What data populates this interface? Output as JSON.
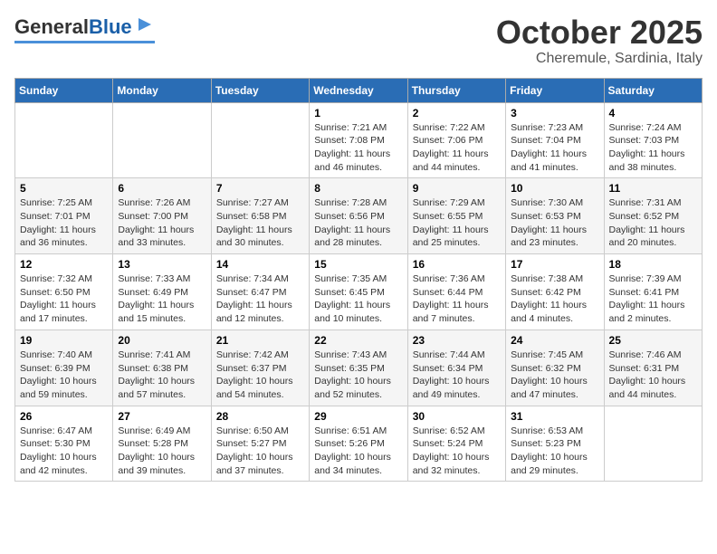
{
  "header": {
    "logo_general": "General",
    "logo_blue": "Blue",
    "month_title": "October 2025",
    "location": "Cheremule, Sardinia, Italy"
  },
  "calendar": {
    "days_of_week": [
      "Sunday",
      "Monday",
      "Tuesday",
      "Wednesday",
      "Thursday",
      "Friday",
      "Saturday"
    ],
    "weeks": [
      [
        {
          "day": "",
          "info": ""
        },
        {
          "day": "",
          "info": ""
        },
        {
          "day": "",
          "info": ""
        },
        {
          "day": "1",
          "info": "Sunrise: 7:21 AM\nSunset: 7:08 PM\nDaylight: 11 hours and 46 minutes."
        },
        {
          "day": "2",
          "info": "Sunrise: 7:22 AM\nSunset: 7:06 PM\nDaylight: 11 hours and 44 minutes."
        },
        {
          "day": "3",
          "info": "Sunrise: 7:23 AM\nSunset: 7:04 PM\nDaylight: 11 hours and 41 minutes."
        },
        {
          "day": "4",
          "info": "Sunrise: 7:24 AM\nSunset: 7:03 PM\nDaylight: 11 hours and 38 minutes."
        }
      ],
      [
        {
          "day": "5",
          "info": "Sunrise: 7:25 AM\nSunset: 7:01 PM\nDaylight: 11 hours and 36 minutes."
        },
        {
          "day": "6",
          "info": "Sunrise: 7:26 AM\nSunset: 7:00 PM\nDaylight: 11 hours and 33 minutes."
        },
        {
          "day": "7",
          "info": "Sunrise: 7:27 AM\nSunset: 6:58 PM\nDaylight: 11 hours and 30 minutes."
        },
        {
          "day": "8",
          "info": "Sunrise: 7:28 AM\nSunset: 6:56 PM\nDaylight: 11 hours and 28 minutes."
        },
        {
          "day": "9",
          "info": "Sunrise: 7:29 AM\nSunset: 6:55 PM\nDaylight: 11 hours and 25 minutes."
        },
        {
          "day": "10",
          "info": "Sunrise: 7:30 AM\nSunset: 6:53 PM\nDaylight: 11 hours and 23 minutes."
        },
        {
          "day": "11",
          "info": "Sunrise: 7:31 AM\nSunset: 6:52 PM\nDaylight: 11 hours and 20 minutes."
        }
      ],
      [
        {
          "day": "12",
          "info": "Sunrise: 7:32 AM\nSunset: 6:50 PM\nDaylight: 11 hours and 17 minutes."
        },
        {
          "day": "13",
          "info": "Sunrise: 7:33 AM\nSunset: 6:49 PM\nDaylight: 11 hours and 15 minutes."
        },
        {
          "day": "14",
          "info": "Sunrise: 7:34 AM\nSunset: 6:47 PM\nDaylight: 11 hours and 12 minutes."
        },
        {
          "day": "15",
          "info": "Sunrise: 7:35 AM\nSunset: 6:45 PM\nDaylight: 11 hours and 10 minutes."
        },
        {
          "day": "16",
          "info": "Sunrise: 7:36 AM\nSunset: 6:44 PM\nDaylight: 11 hours and 7 minutes."
        },
        {
          "day": "17",
          "info": "Sunrise: 7:38 AM\nSunset: 6:42 PM\nDaylight: 11 hours and 4 minutes."
        },
        {
          "day": "18",
          "info": "Sunrise: 7:39 AM\nSunset: 6:41 PM\nDaylight: 11 hours and 2 minutes."
        }
      ],
      [
        {
          "day": "19",
          "info": "Sunrise: 7:40 AM\nSunset: 6:39 PM\nDaylight: 10 hours and 59 minutes."
        },
        {
          "day": "20",
          "info": "Sunrise: 7:41 AM\nSunset: 6:38 PM\nDaylight: 10 hours and 57 minutes."
        },
        {
          "day": "21",
          "info": "Sunrise: 7:42 AM\nSunset: 6:37 PM\nDaylight: 10 hours and 54 minutes."
        },
        {
          "day": "22",
          "info": "Sunrise: 7:43 AM\nSunset: 6:35 PM\nDaylight: 10 hours and 52 minutes."
        },
        {
          "day": "23",
          "info": "Sunrise: 7:44 AM\nSunset: 6:34 PM\nDaylight: 10 hours and 49 minutes."
        },
        {
          "day": "24",
          "info": "Sunrise: 7:45 AM\nSunset: 6:32 PM\nDaylight: 10 hours and 47 minutes."
        },
        {
          "day": "25",
          "info": "Sunrise: 7:46 AM\nSunset: 6:31 PM\nDaylight: 10 hours and 44 minutes."
        }
      ],
      [
        {
          "day": "26",
          "info": "Sunrise: 6:47 AM\nSunset: 5:30 PM\nDaylight: 10 hours and 42 minutes."
        },
        {
          "day": "27",
          "info": "Sunrise: 6:49 AM\nSunset: 5:28 PM\nDaylight: 10 hours and 39 minutes."
        },
        {
          "day": "28",
          "info": "Sunrise: 6:50 AM\nSunset: 5:27 PM\nDaylight: 10 hours and 37 minutes."
        },
        {
          "day": "29",
          "info": "Sunrise: 6:51 AM\nSunset: 5:26 PM\nDaylight: 10 hours and 34 minutes."
        },
        {
          "day": "30",
          "info": "Sunrise: 6:52 AM\nSunset: 5:24 PM\nDaylight: 10 hours and 32 minutes."
        },
        {
          "day": "31",
          "info": "Sunrise: 6:53 AM\nSunset: 5:23 PM\nDaylight: 10 hours and 29 minutes."
        },
        {
          "day": "",
          "info": ""
        }
      ]
    ]
  }
}
